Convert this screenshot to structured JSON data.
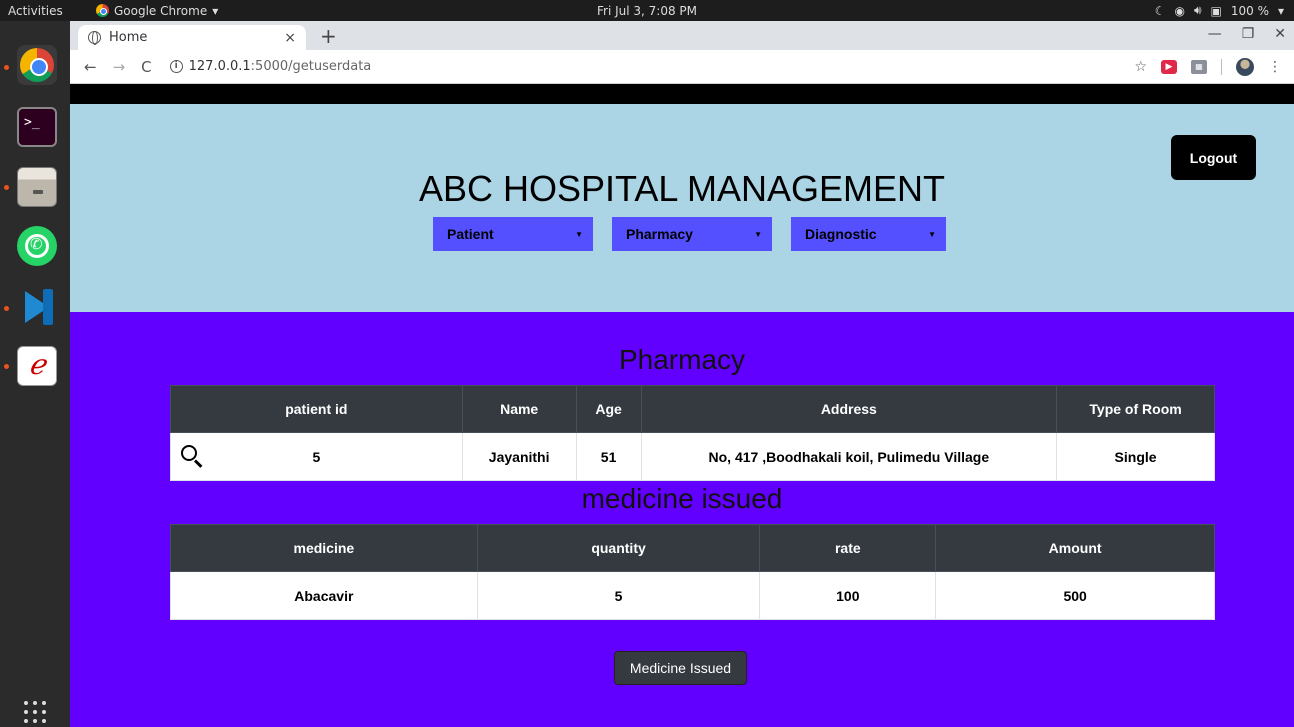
{
  "system": {
    "activities": "Activities",
    "app_name": "Google Chrome",
    "app_caret": "▾",
    "clock": "Fri Jul  3,  7:08 PM",
    "battery": "100 %",
    "icons": [
      "moon-icon",
      "wifi-icon",
      "volume-icon",
      "battery-icon"
    ]
  },
  "dock": {
    "apps": [
      "chrome",
      "terminal",
      "files",
      "whatsapp",
      "vscode",
      "evince"
    ],
    "terminal_glyph": ">_",
    "evince_glyph": "ℯ"
  },
  "browser": {
    "tab_title": "Home",
    "tab_close": "×",
    "new_tab": "+",
    "url_host": "127.0.0.1",
    "url_path": ":5000/getuserdata",
    "info_glyph": "i"
  },
  "page": {
    "title": "ABC HOSPITAL MANAGEMENT",
    "logout_label": "Logout",
    "header_bg": "#abd4e5",
    "main_bg": "#6200ff",
    "select_bg": "#5450ff",
    "menus": [
      "Patient",
      "Pharmacy",
      "Diagnostic"
    ],
    "section_title": "Pharmacy",
    "patient_table": {
      "headers": [
        "patient id",
        "Name",
        "Age",
        "Address",
        "Type of Room"
      ],
      "row": [
        "5",
        "Jayanithi",
        "51",
        "No, 417 ,Boodhakali koil, Pulimedu Village",
        "Single"
      ]
    },
    "medicine_title": "medicine issued",
    "medicine_table": {
      "headers": [
        "medicine",
        "quantity",
        "rate",
        "Amount"
      ],
      "row": [
        "Abacavir",
        "5",
        "100",
        "500"
      ]
    },
    "issued_button": "Medicine Issued"
  }
}
